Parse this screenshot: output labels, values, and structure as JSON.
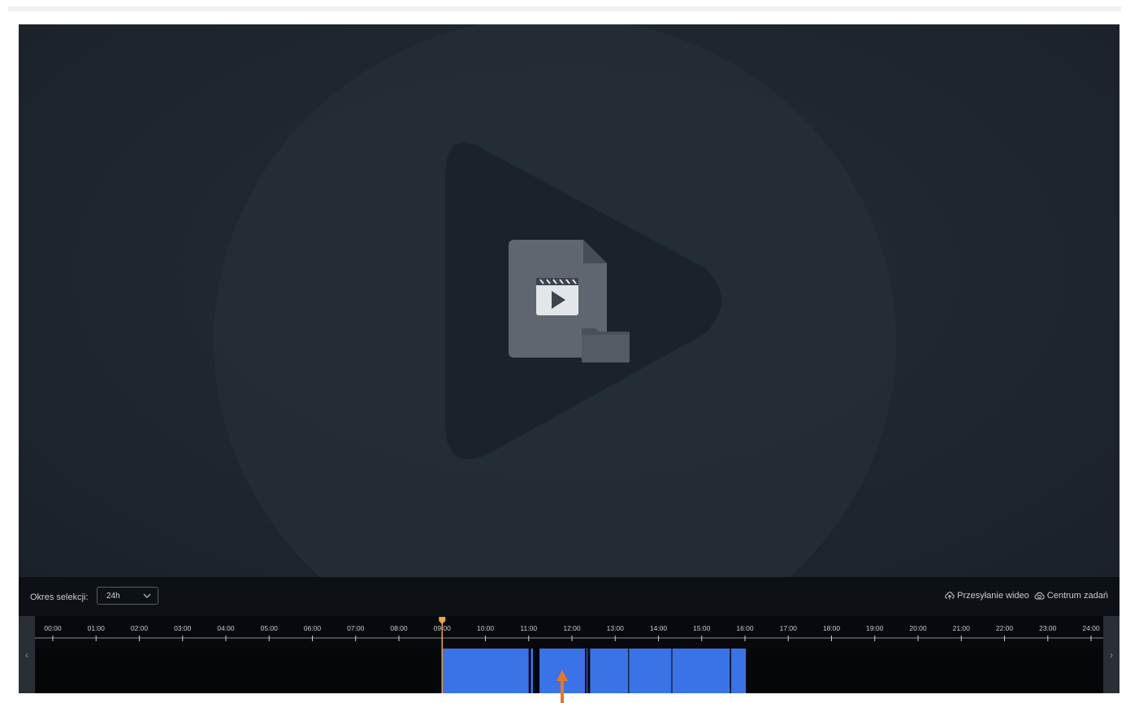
{
  "player": {
    "placeholder_icon": "video-file-folder-icon",
    "background_icon": "play-triangle-icon"
  },
  "controls": {
    "selection_label": "Okres selekcji:",
    "selection_value": "24h",
    "upload_label": "Przesyłanie wideo",
    "upload_icon": "cloud-upload-icon",
    "tasks_label": "Centrum zadań",
    "tasks_icon": "cloud-tasks-icon"
  },
  "timeline": {
    "hours": [
      "00:00",
      "01:00",
      "02:00",
      "03:00",
      "04:00",
      "05:00",
      "06:00",
      "07:00",
      "08:00",
      "09:00",
      "10:00",
      "11:00",
      "12:00",
      "13:00",
      "14:00",
      "15:00",
      "16:00",
      "17:00",
      "18:00",
      "19:00",
      "20:00",
      "21:00",
      "22:00",
      "23:00",
      "24:00"
    ],
    "cursor_time_hours": 9.0,
    "cursor_color": "#f0a640",
    "segment_color": "#3a73e8",
    "recording_segments": [
      [
        9.0,
        11.0
      ],
      [
        11.05,
        11.1
      ],
      [
        11.25,
        12.3
      ],
      [
        12.34,
        12.36
      ],
      [
        12.42,
        13.3
      ],
      [
        13.32,
        14.3
      ],
      [
        14.32,
        15.65
      ],
      [
        15.68,
        16.02
      ]
    ],
    "left_arrow": "‹",
    "right_arrow": "›"
  },
  "annotation": {
    "color": "#e87722"
  }
}
